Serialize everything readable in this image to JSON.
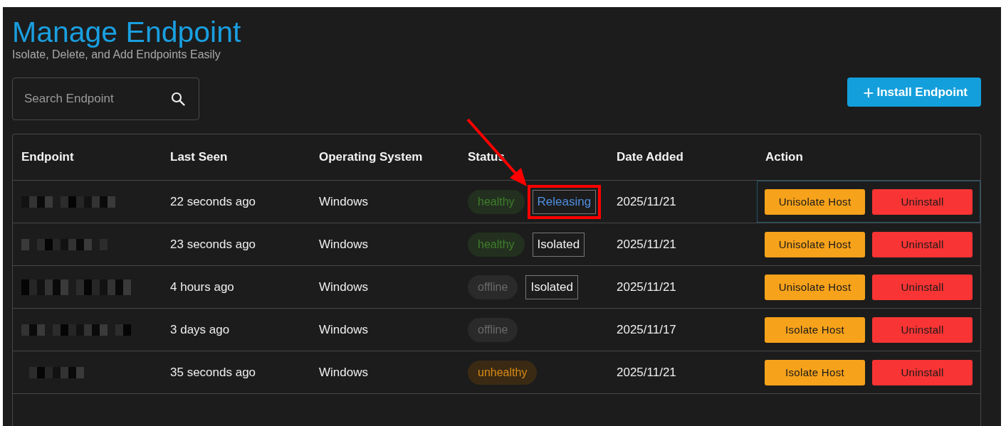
{
  "header": {
    "title": "Manage Endpoint",
    "subtitle": "Isolate, Delete, and Add Endpoints Easily"
  },
  "search": {
    "placeholder": "Search Endpoint"
  },
  "install_button": {
    "icon": "+",
    "label": "Install Endpoint"
  },
  "table": {
    "columns": [
      "Endpoint",
      "Last Seen",
      "Operating System",
      "Status",
      "Date Added",
      "Action"
    ],
    "rows": [
      {
        "selected": true,
        "last_seen": "22 seconds ago",
        "os": "Windows",
        "health": {
          "label": "healthy",
          "kind": "healthy"
        },
        "isolation": {
          "label": "Releasing",
          "kind": "releasing",
          "highlighted": true
        },
        "date_added": "2025/11/21",
        "actions": [
          {
            "label": "Unisolate Host",
            "kind": "isolate"
          },
          {
            "label": "Uninstall",
            "kind": "uninstall"
          }
        ]
      },
      {
        "selected": false,
        "last_seen": "23 seconds ago",
        "os": "Windows",
        "health": {
          "label": "healthy",
          "kind": "healthy"
        },
        "isolation": {
          "label": "Isolated",
          "kind": "isolated",
          "highlighted": false
        },
        "date_added": "2025/11/21",
        "actions": [
          {
            "label": "Unisolate Host",
            "kind": "isolate"
          },
          {
            "label": "Uninstall",
            "kind": "uninstall"
          }
        ]
      },
      {
        "selected": false,
        "last_seen": "4 hours ago",
        "os": "Windows",
        "health": {
          "label": "offline",
          "kind": "offline"
        },
        "isolation": {
          "label": "Isolated",
          "kind": "isolated",
          "highlighted": false
        },
        "date_added": "2025/11/21",
        "actions": [
          {
            "label": "Unisolate Host",
            "kind": "isolate"
          },
          {
            "label": "Uninstall",
            "kind": "uninstall"
          }
        ]
      },
      {
        "selected": false,
        "last_seen": "3 days ago",
        "os": "Windows",
        "health": {
          "label": "offline",
          "kind": "offline"
        },
        "date_added": "2025/11/17",
        "actions": [
          {
            "label": "Isolate Host",
            "kind": "isolate"
          },
          {
            "label": "Uninstall",
            "kind": "uninstall"
          }
        ]
      },
      {
        "selected": false,
        "last_seen": "35 seconds ago",
        "os": "Windows",
        "health": {
          "label": "unhealthy",
          "kind": "unhealthy"
        },
        "date_added": "2025/11/21",
        "actions": [
          {
            "label": "Isolate Host",
            "kind": "isolate"
          },
          {
            "label": "Uninstall",
            "kind": "uninstall"
          }
        ]
      }
    ]
  }
}
